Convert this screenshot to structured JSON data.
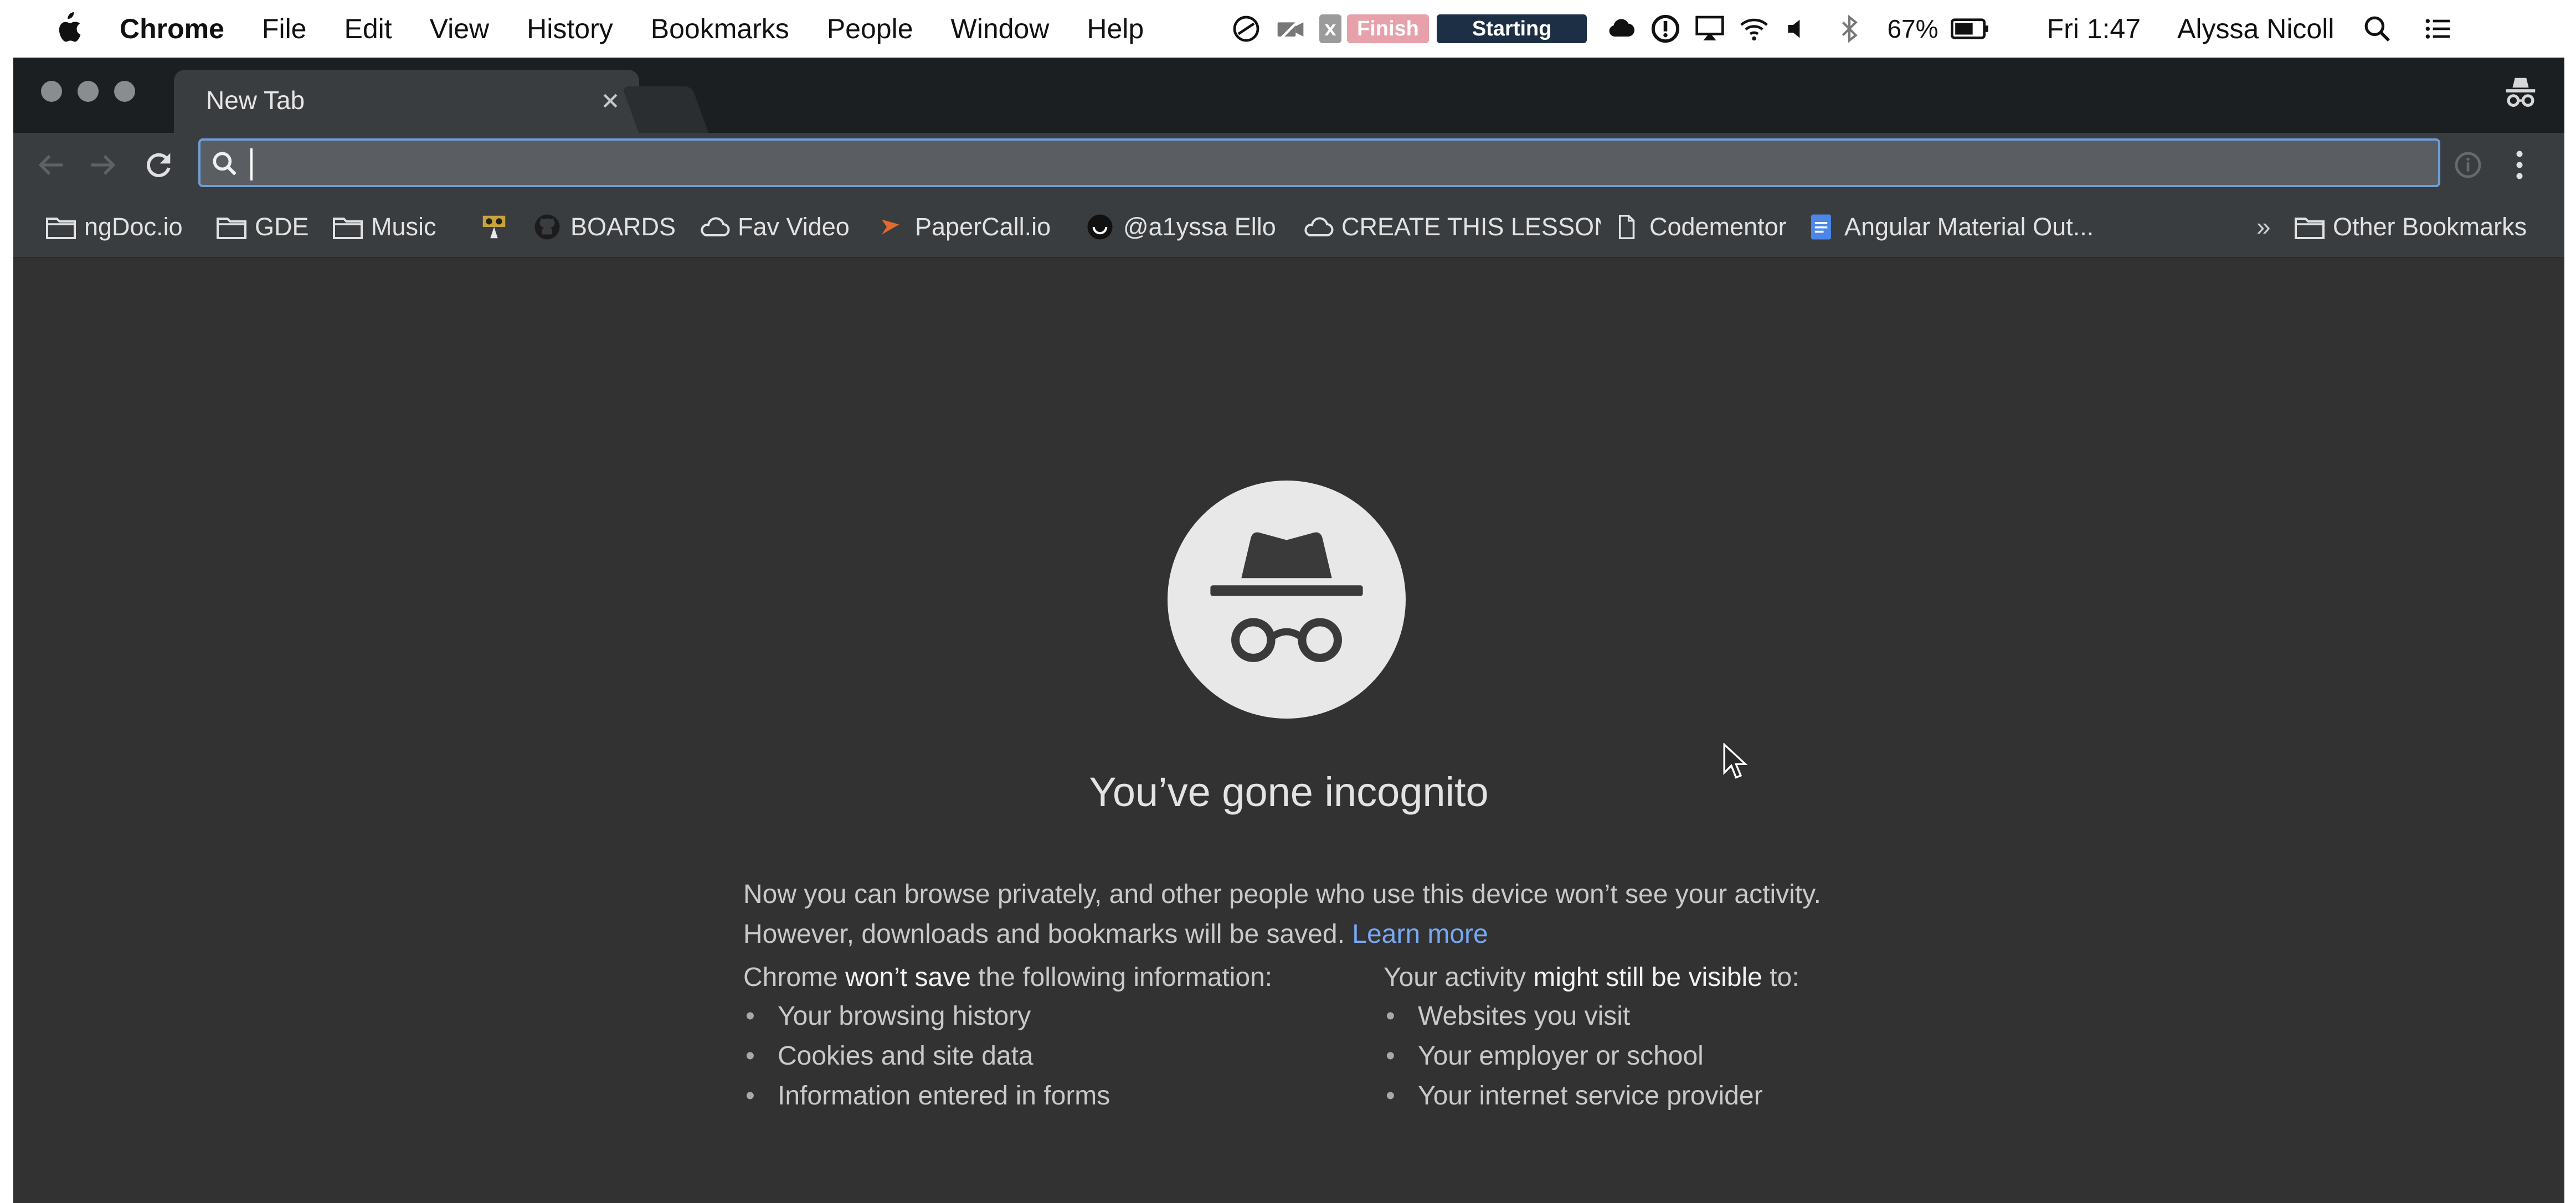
{
  "menubar": {
    "app_name": "Chrome",
    "items": [
      "File",
      "Edit",
      "View",
      "History",
      "Bookmarks",
      "People",
      "Window",
      "Help"
    ],
    "status": {
      "x_label": "x",
      "finish_label": "Finish",
      "starting_label": "Starting",
      "battery": "67%",
      "clock": "Fri 1:47",
      "user": "Alyssa Nicoll"
    }
  },
  "tab": {
    "title": "New Tab"
  },
  "omnibox": {
    "value": ""
  },
  "bookmarks": {
    "items": [
      "ngDoc.io",
      "GDE",
      "Music",
      "BOARDS",
      "Fav Video",
      "PaperCall.io",
      "@a1yssa Ello",
      "CREATE THIS LESSON",
      "Codementor",
      "Angular Material Out..."
    ],
    "more": "»",
    "other": "Other Bookmarks"
  },
  "incognito": {
    "heading": "You’ve gone incognito",
    "description": "Now you can browse privately, and other people who use this device won’t see your activity. However, downloads and bookmarks will be saved.",
    "learn_more": "Learn more",
    "left_title_pre": "Chrome ",
    "left_title_bold": "won’t save",
    "left_title_post": " the following information:",
    "left_items": [
      "Your browsing history",
      "Cookies and site data",
      "Information entered in forms"
    ],
    "right_title_pre": "Your activity ",
    "right_title_bold": "might still be visible",
    "right_title_post": " to:",
    "right_items": [
      "Websites you visit",
      "Your employer or school",
      "Your internet service provider"
    ]
  },
  "colors": {
    "window_bg": "#323232",
    "toolbar_bg": "#3a3d40",
    "tabstrip_bg": "#1c1f22",
    "link": "#78a9f4",
    "omnibox_focus": "#6d9ed8"
  }
}
